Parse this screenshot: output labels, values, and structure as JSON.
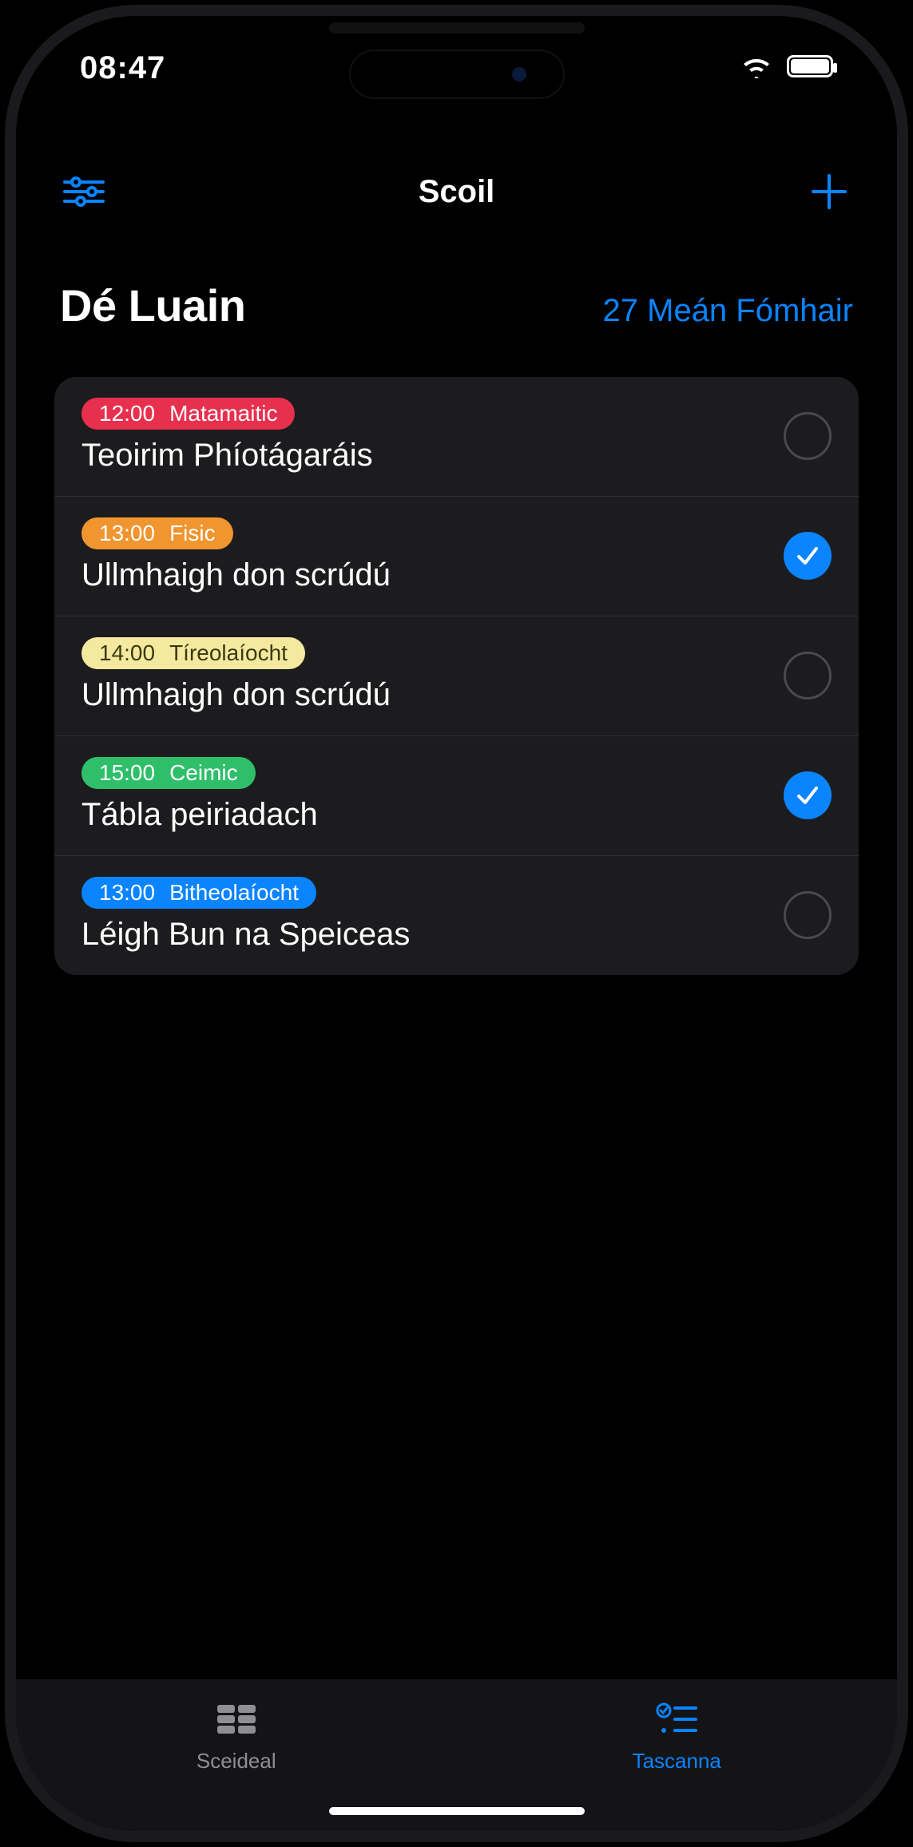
{
  "status": {
    "time": "08:47"
  },
  "nav": {
    "title": "Scoil"
  },
  "header": {
    "day": "Dé Luain",
    "date": "27 Meán Fómhair"
  },
  "colors": {
    "accent": "#0a84ff",
    "pills": {
      "red": {
        "bg": "#e7304e",
        "fg": "#ffffff"
      },
      "orange": {
        "bg": "#f0952f",
        "fg": "#ffffff"
      },
      "yellow": {
        "bg": "#f4e99f",
        "fg": "#3a3a10"
      },
      "green": {
        "bg": "#2fbf6a",
        "fg": "#ffffff"
      },
      "blue": {
        "bg": "#0a84ff",
        "fg": "#ffffff"
      }
    }
  },
  "tasks": [
    {
      "time": "12:00",
      "subject": "Matamaitic",
      "title": "Teoirim Phíotágaráis",
      "color": "red",
      "done": false
    },
    {
      "time": "13:00",
      "subject": "Fisic",
      "title": "Ullmhaigh don scrúdú",
      "color": "orange",
      "done": true
    },
    {
      "time": "14:00",
      "subject": "Tíreolaíocht",
      "title": "Ullmhaigh don scrúdú",
      "color": "yellow",
      "done": false
    },
    {
      "time": "15:00",
      "subject": "Ceimic",
      "title": "Tábla peiriadach",
      "color": "green",
      "done": true
    },
    {
      "time": "13:00",
      "subject": "Bitheolaíocht",
      "title": "Léigh Bun na Speiceas",
      "color": "blue",
      "done": false
    }
  ],
  "tabs": {
    "schedule": {
      "label": "Sceideal",
      "active": false
    },
    "tasks": {
      "label": "Tascanna",
      "active": true
    }
  }
}
